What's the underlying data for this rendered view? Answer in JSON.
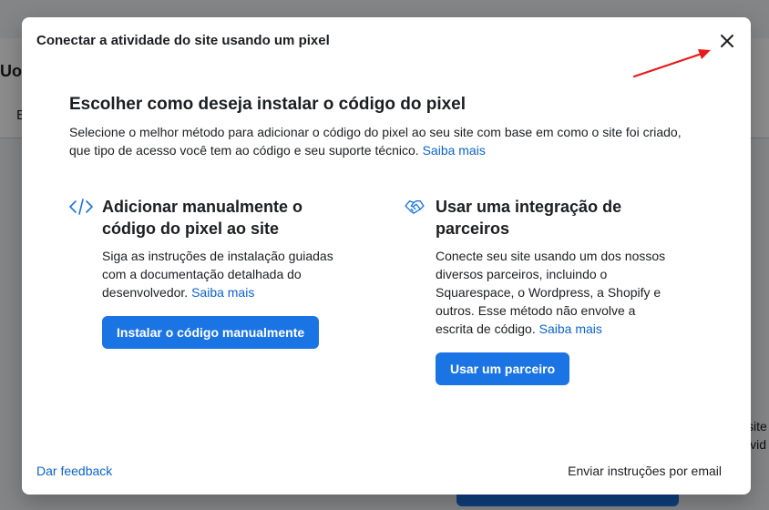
{
  "background": {
    "title": "Uoc",
    "tab": "E",
    "side_text_1": "site",
    "side_text_2": "ivid"
  },
  "modal": {
    "title": "Conectar a atividade do site usando um pixel",
    "close_icon": "close-icon",
    "heading": "Escolher como deseja instalar o código do pixel",
    "intro_text": "Selecione o melhor método para adicionar o código do pixel ao seu site com base em como o site foi criado, que tipo de acesso você tem ao código e seu suporte técnico.",
    "intro_link": "Saiba mais",
    "options": [
      {
        "icon": "code-icon",
        "title": "Adicionar manualmente o código do pixel ao site",
        "description": "Siga as instruções de instalação guiadas com a documentação detalhada do desenvolvedor.",
        "link": "Saiba mais",
        "button": "Instalar o código manualmente"
      },
      {
        "icon": "handshake-icon",
        "title": "Usar uma integração de parceiros",
        "description": "Conecte seu site usando um dos nossos diversos parceiros, incluindo o Squarespace, o Wordpress, a Shopify e outros. Esse método não envolve a escrita de código.",
        "link": "Saiba mais",
        "button": "Usar um parceiro"
      }
    ],
    "feedback_link": "Dar feedback",
    "email_link": "Enviar instruções por email"
  },
  "colors": {
    "primary": "#1b74e4",
    "link": "#0b63ce",
    "annotation_arrow": "#e8191a"
  }
}
